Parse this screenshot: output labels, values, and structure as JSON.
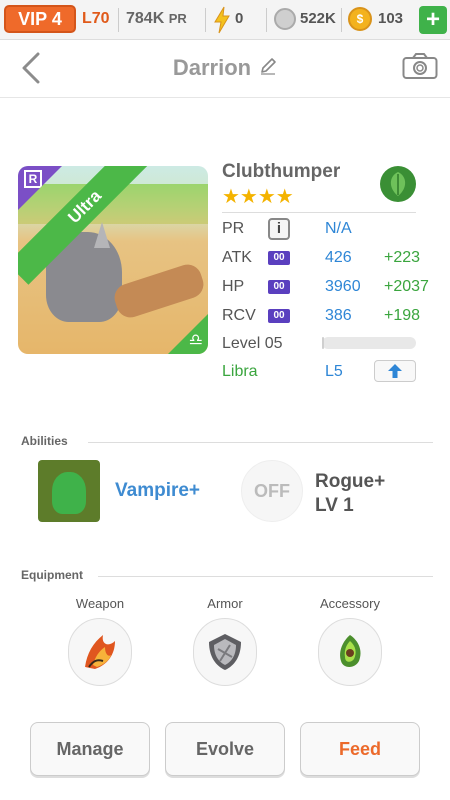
{
  "status_bar": {
    "vip": "VIP 4",
    "level": "L70",
    "power": "784K",
    "power_unit": "PR",
    "energy": "0",
    "food": "522K",
    "coins": "103",
    "add": "+"
  },
  "header": {
    "title": "Darrion"
  },
  "pet": {
    "rarity": "Ultra",
    "rank_badge": "R",
    "zodiac_symbol": "♎",
    "name": "Clubthumper",
    "stars": 4,
    "star_text": "★★★★",
    "stats": {
      "pr_label": "PR",
      "pr_info": "i",
      "pr_value": "N/A",
      "atk_label": "ATK",
      "atk_tag": "00",
      "atk_value": "426",
      "atk_bonus": "+223",
      "hp_label": "HP",
      "hp_tag": "00",
      "hp_value": "3960",
      "hp_bonus": "+2037",
      "rcv_label": "RCV",
      "rcv_tag": "00",
      "rcv_value": "386",
      "rcv_bonus": "+198",
      "level_label": "Level 05",
      "level_progress": 0.02,
      "sign_label": "Libra",
      "sign_level": "L5"
    },
    "colors": {
      "ultra": "#4cb848",
      "rank": "#7b4fc6",
      "value": "#2e86d6",
      "bonus": "#3aa53e"
    }
  },
  "abilities": {
    "section_title": "Abilities",
    "primary": "Vampire+",
    "secondary_state": "OFF",
    "secondary_name": "Rogue+",
    "secondary_level": "LV 1"
  },
  "equipment": {
    "section_title": "Equipment",
    "slots": [
      {
        "label": "Weapon",
        "icon": "flame-claw-icon"
      },
      {
        "label": "Armor",
        "icon": "stone-shield-icon"
      },
      {
        "label": "Accessory",
        "icon": "green-gem-icon"
      }
    ]
  },
  "actions": {
    "manage": "Manage",
    "evolve": "Evolve",
    "feed": "Feed"
  }
}
